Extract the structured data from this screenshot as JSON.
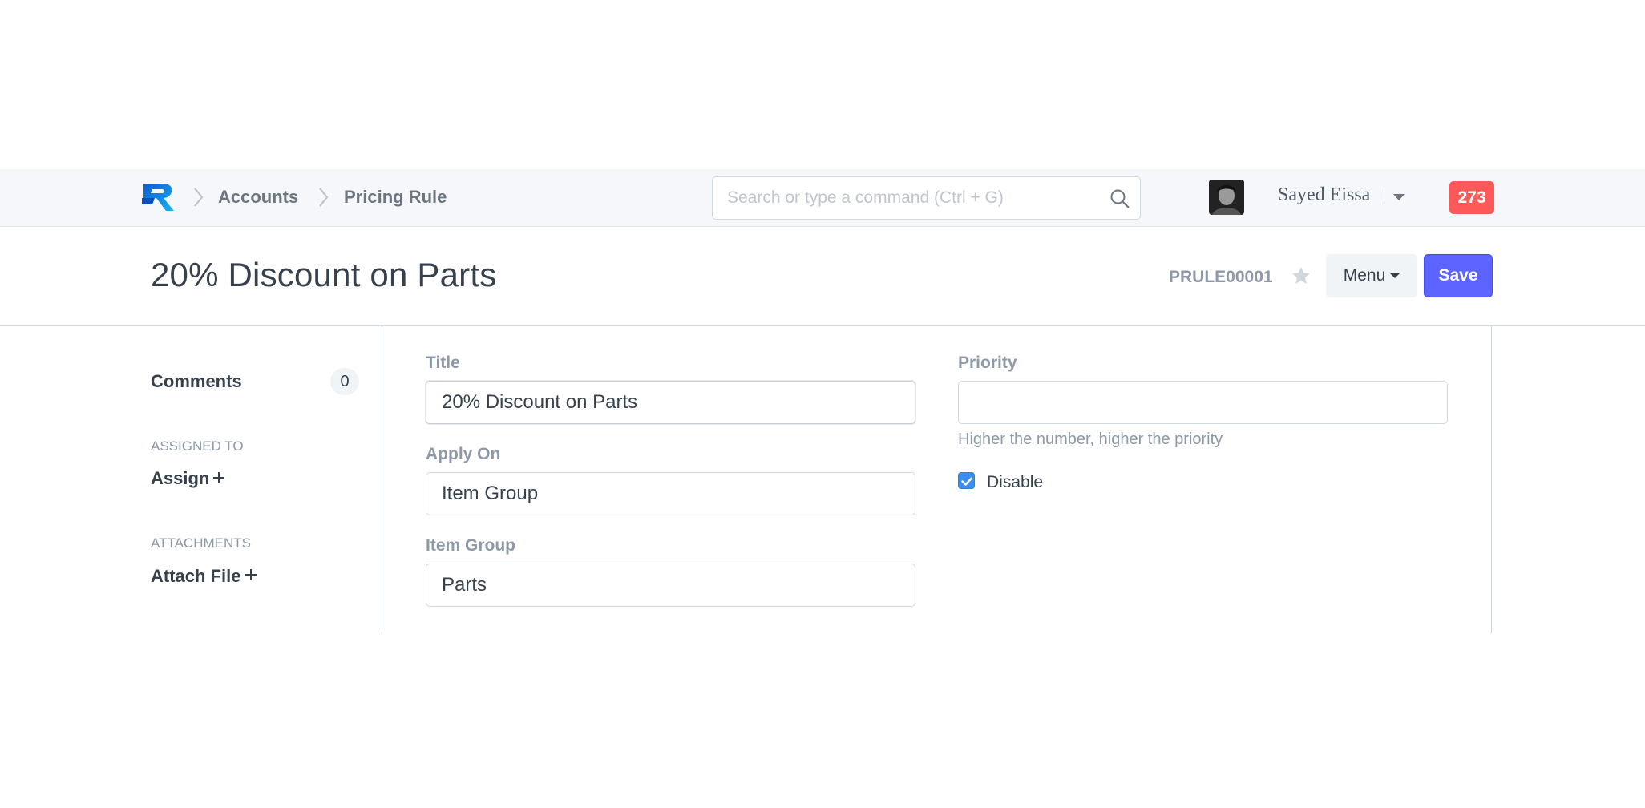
{
  "navbar": {
    "breadcrumbs": [
      "Accounts",
      "Pricing Rule"
    ],
    "search_placeholder": "Search or type a command (Ctrl + G)",
    "user_name": "Sayed Eissa",
    "notification_count": "273"
  },
  "page": {
    "title": "20% Discount on Parts",
    "doc_id": "PRULE00001",
    "menu_label": "Menu",
    "save_label": "Save"
  },
  "sidebar": {
    "comments_label": "Comments",
    "comments_count": "0",
    "assigned_to_heading": "ASSIGNED TO",
    "assign_label": "Assign",
    "attachments_heading": "ATTACHMENTS",
    "attach_label": "Attach File"
  },
  "form": {
    "title_label": "Title",
    "title_value": "20% Discount on Parts",
    "apply_on_label": "Apply On",
    "apply_on_value": "Item Group",
    "item_group_label": "Item Group",
    "item_group_value": "Parts",
    "priority_label": "Priority",
    "priority_value": "",
    "priority_help": "Higher the number, higher the priority",
    "disable_label": "Disable",
    "disable_checked": true
  },
  "colors": {
    "primary": "#5e64ff",
    "notification": "#ff5858",
    "checkbox": "#3b8ef0"
  }
}
